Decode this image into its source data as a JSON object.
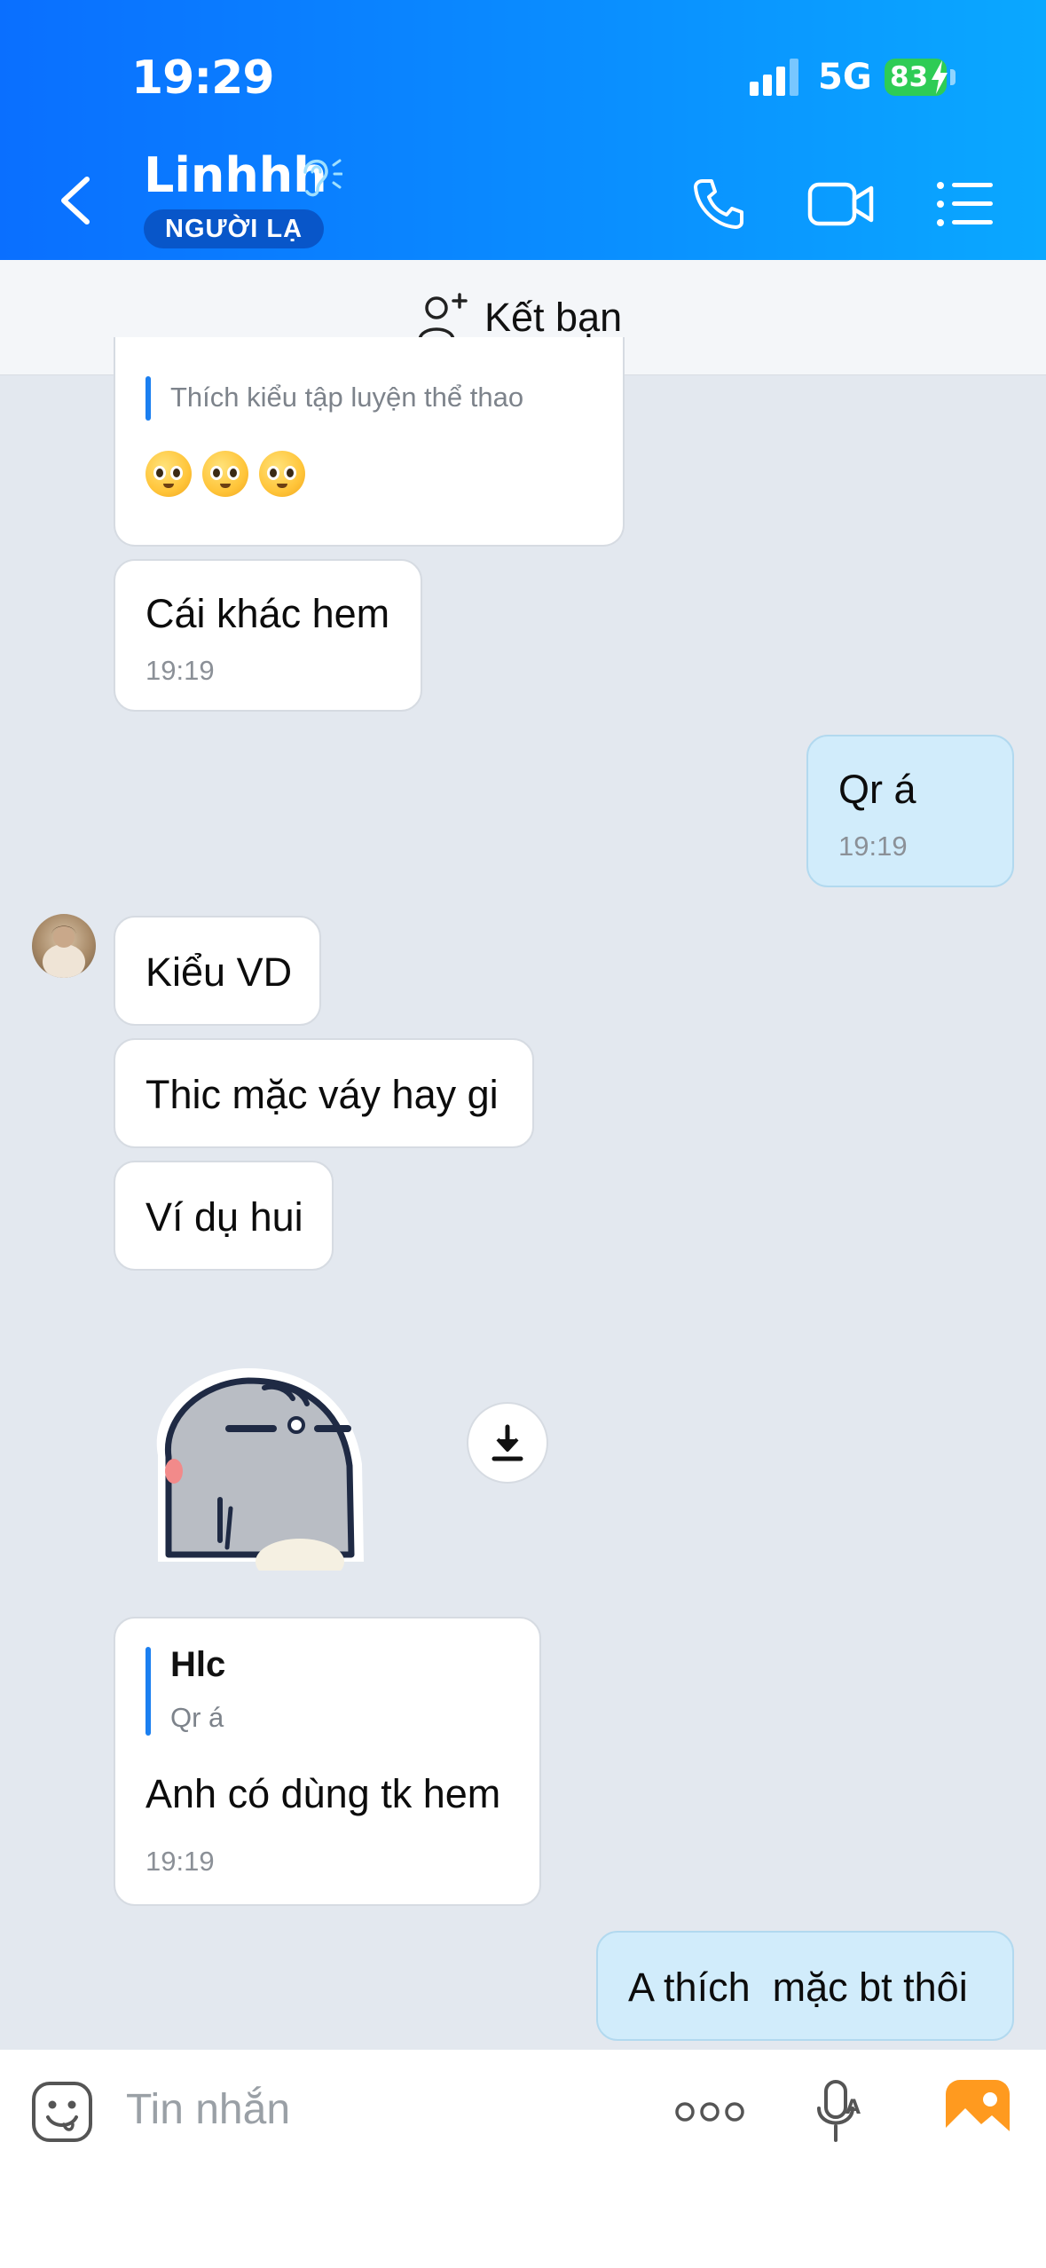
{
  "status_bar": {
    "time": "19:29",
    "network": "5G",
    "battery": "83"
  },
  "header": {
    "contact_name": "Linhhh",
    "badge": "NGƯỜI LẠ"
  },
  "friend_bar": {
    "label": "Kết bạn"
  },
  "messages": [
    {
      "quote": "Thích kiểu tập luyện thể thao"
    },
    {
      "text": "Cái khác hem",
      "time": "19:19"
    },
    {
      "text": "Qr á",
      "time": "19:19"
    },
    {
      "text": "Kiểu VD"
    },
    {
      "text": "Thic mặc váy hay gi"
    },
    {
      "text": "Ví dụ hui"
    },
    {
      "quote_title": "Hlc",
      "quote": "Qr á",
      "text": "Anh có dùng tk hem",
      "time": "19:19"
    },
    {
      "text": "A thích  mặc bt thôi"
    }
  ],
  "input": {
    "placeholder": "Tin nhắn"
  },
  "colors": {
    "header": "#0a8dff",
    "my_bubble": "#d1ecfb",
    "background": "#e3e8ef",
    "quote_bar": "#1b7ff0"
  },
  "icons": [
    "back-icon",
    "ear-icon",
    "phone-icon",
    "video-icon",
    "menu-icon",
    "add-friend-icon",
    "download-icon",
    "emoji-icon",
    "more-icon",
    "voice-icon",
    "gallery-icon"
  ]
}
